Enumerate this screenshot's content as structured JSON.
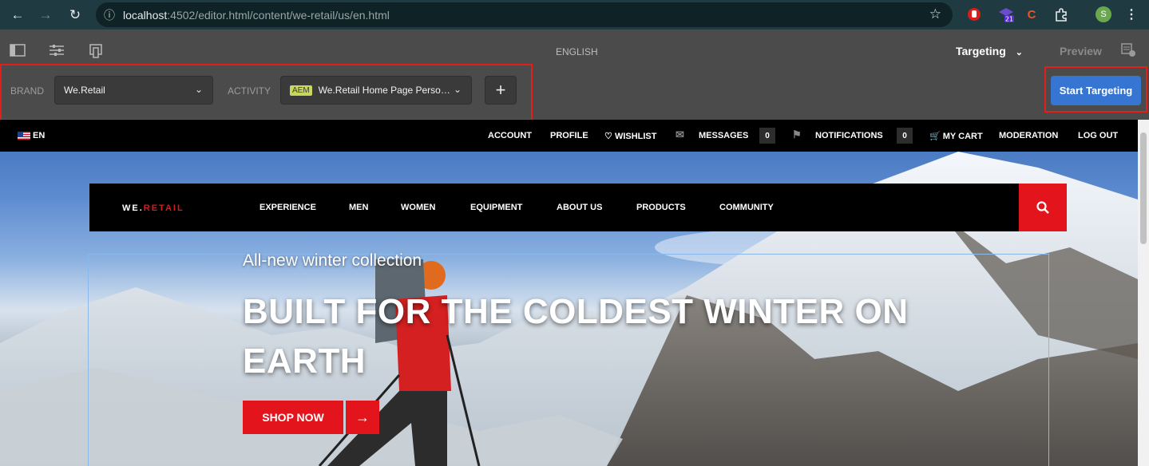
{
  "browser": {
    "url_host": "localhost",
    "url_rest": ":4502/editor.html/content/we-retail/us/en.html",
    "ext_badge": "21",
    "profile_initial": "S"
  },
  "toolbar": {
    "language": "ENGLISH",
    "mode": "Targeting",
    "preview": "Preview",
    "brand_label": "BRAND",
    "brand_value": "We.Retail",
    "activity_label": "ACTIVITY",
    "activity_badge": "AEM",
    "activity_value": "We.Retail Home Page Perso…",
    "add_label": "+",
    "start_label": "Start Targeting"
  },
  "topbar": {
    "lang": "EN",
    "account": "ACCOUNT",
    "profile": "PROFILE",
    "wishlist": "WISHLIST",
    "messages": "MESSAGES",
    "messages_count": "0",
    "notifications": "NOTIFICATIONS",
    "notifications_count": "0",
    "cart": "MY CART",
    "moderation": "MODERATION",
    "logout": "LOG OUT"
  },
  "site": {
    "logo_a": "WE.",
    "logo_b": "RETAIL",
    "nav": [
      "EXPERIENCE",
      "MEN",
      "WOMEN",
      "EQUIPMENT",
      "ABOUT US",
      "PRODUCTS",
      "COMMUNITY"
    ]
  },
  "hero": {
    "subtitle": "All-new winter collection",
    "title": "BUILT FOR THE COLDEST WINTER ON EARTH",
    "cta": "SHOP NOW"
  },
  "colors": {
    "accent_red": "#e3141b",
    "primary_blue": "#3775d2",
    "highlight_box": "#e1201b"
  }
}
